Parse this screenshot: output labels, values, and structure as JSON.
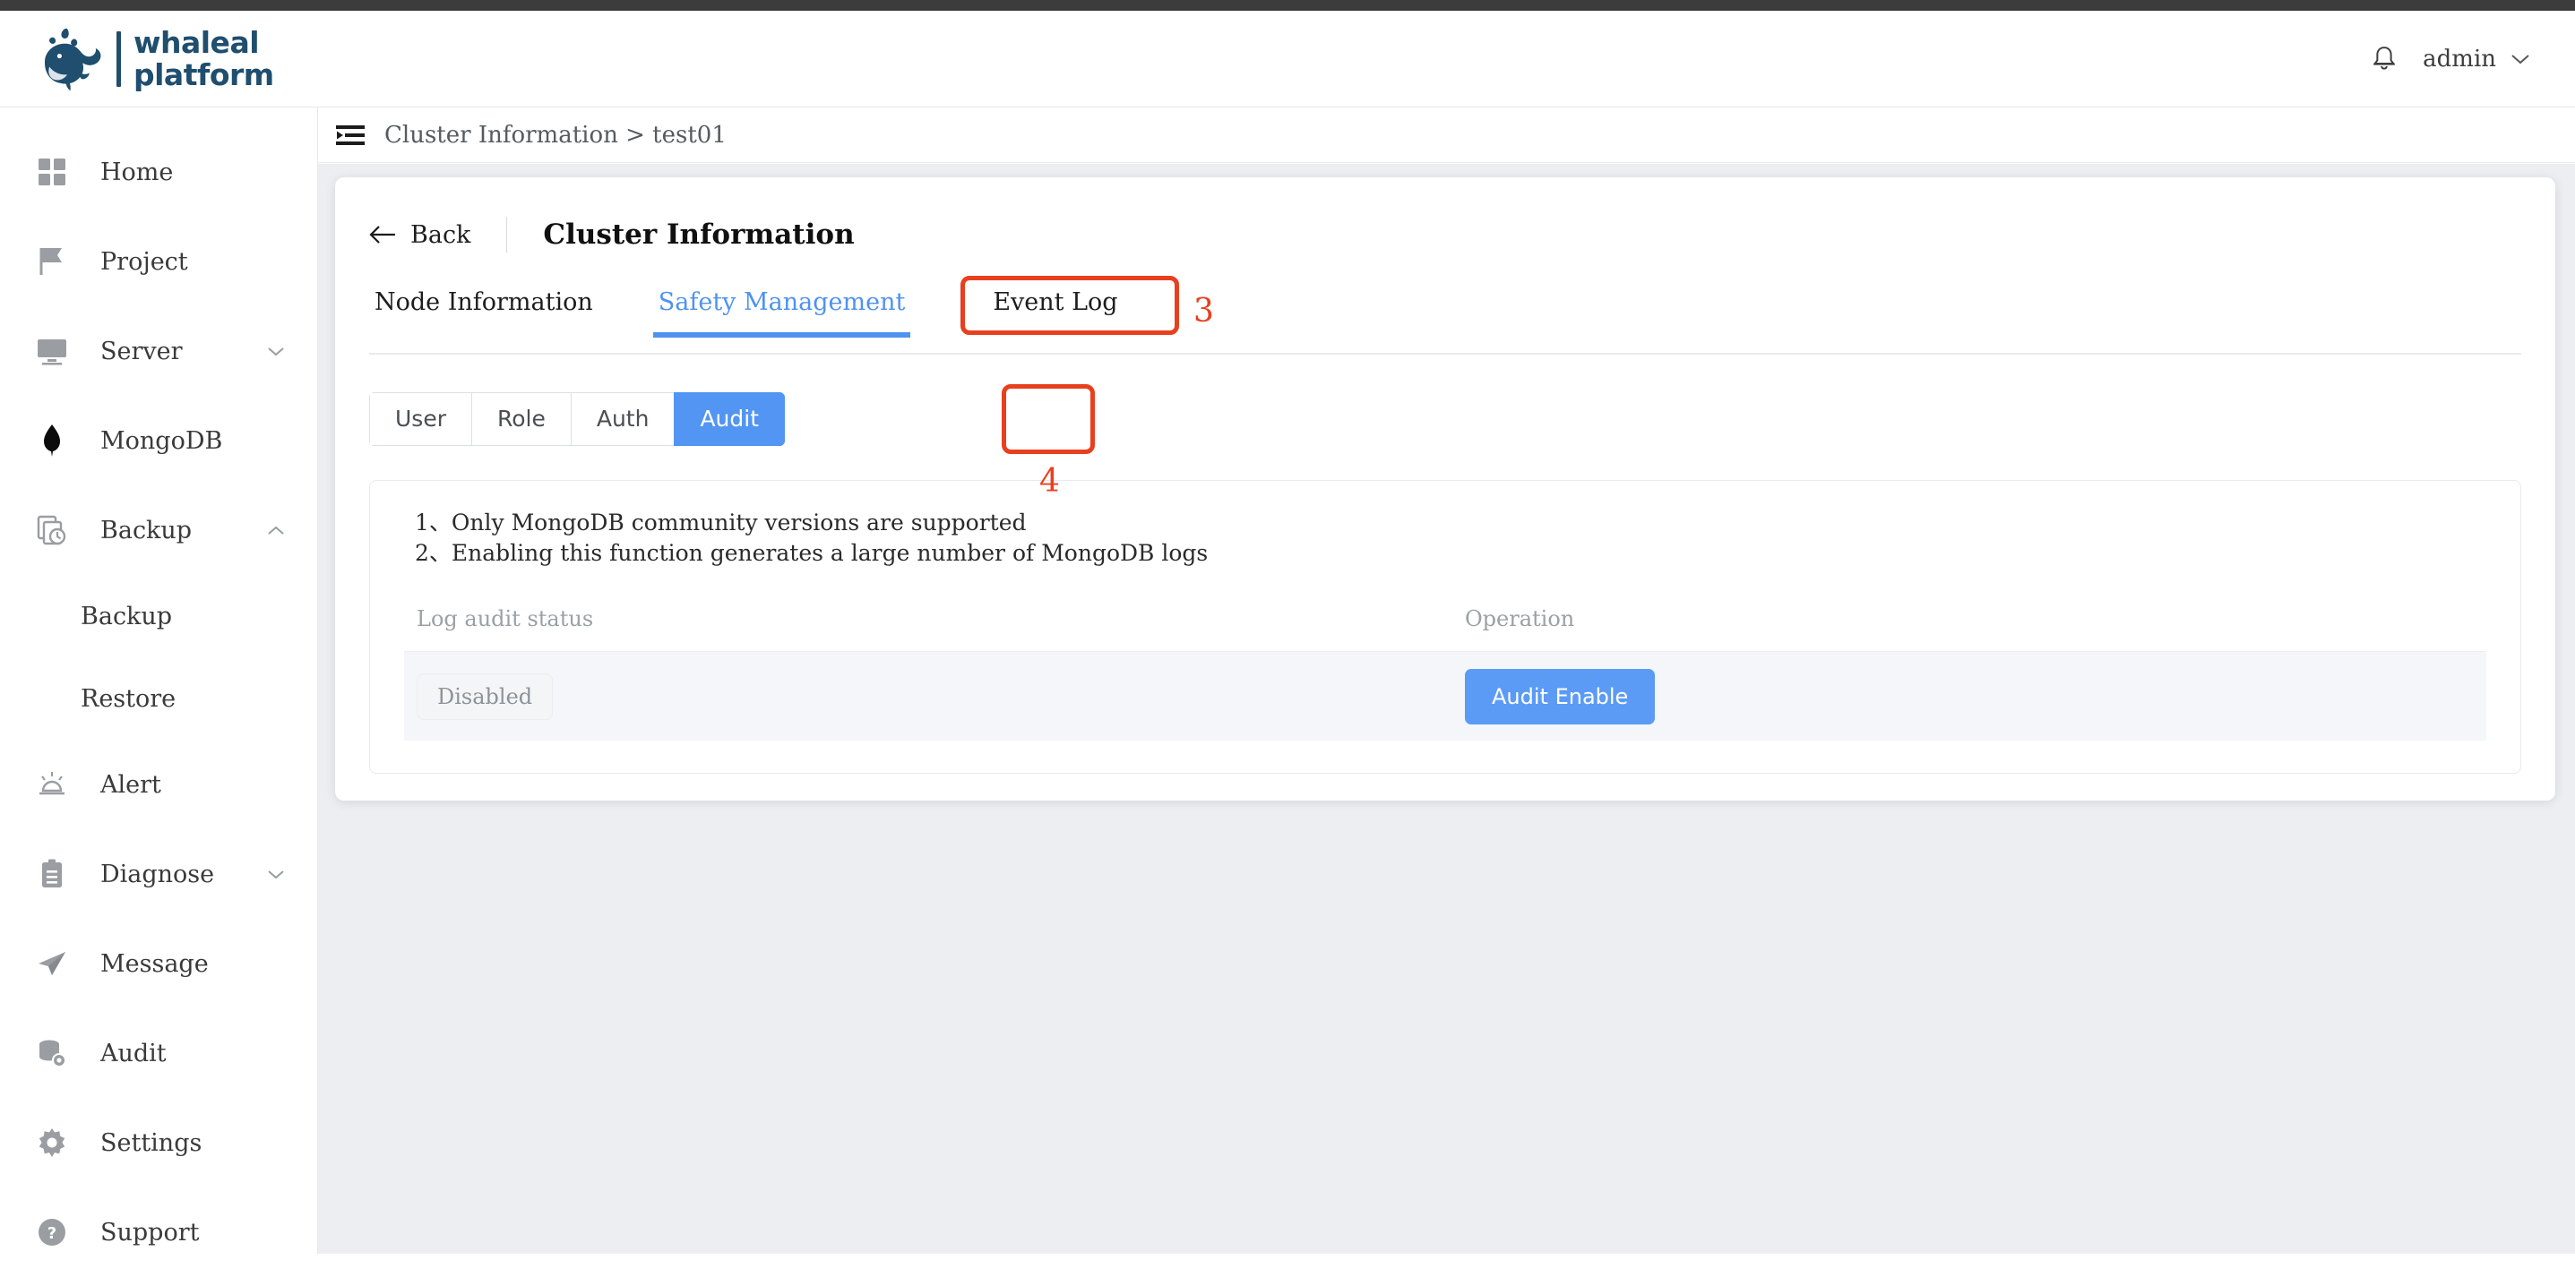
{
  "brand": {
    "logo_icon": "whale-logo-icon",
    "line1": "whaleal",
    "line2": "platform",
    "color": "#1f4e6e"
  },
  "topbar": {
    "notification_icon": "bell-icon",
    "user_name": "admin",
    "user_caret_icon": "chevron-down-icon"
  },
  "sidebar": {
    "items": [
      {
        "label": "Home",
        "icon": "grid-icon",
        "expandable": false
      },
      {
        "label": "Project",
        "icon": "flag-icon",
        "expandable": false
      },
      {
        "label": "Server",
        "icon": "monitor-icon",
        "expandable": true,
        "caret": "chevron-down-icon"
      },
      {
        "label": "MongoDB",
        "icon": "mongodb-leaf-icon",
        "expandable": false
      },
      {
        "label": "Backup",
        "icon": "backup-clock-icon",
        "expandable": true,
        "caret": "chevron-up-icon"
      },
      {
        "label": "Backup",
        "icon": "",
        "sub": true
      },
      {
        "label": "Restore",
        "icon": "",
        "sub": true
      },
      {
        "label": "Alert",
        "icon": "alarm-icon",
        "expandable": false
      },
      {
        "label": "Diagnose",
        "icon": "clipboard-icon",
        "expandable": true,
        "caret": "chevron-down-icon"
      },
      {
        "label": "Message",
        "icon": "send-icon",
        "expandable": false
      },
      {
        "label": "Audit",
        "icon": "database-eye-icon",
        "expandable": false
      },
      {
        "label": "Settings",
        "icon": "gear-icon",
        "expandable": false
      },
      {
        "label": "Support",
        "icon": "question-circle-icon",
        "expandable": false
      }
    ]
  },
  "breadcrumb": {
    "menu_icon": "collapse-menu-icon",
    "text": "Cluster Information > test01"
  },
  "card": {
    "back_icon": "arrow-left-icon",
    "back_label": "Back",
    "title": "Cluster Information",
    "tabs": [
      {
        "label": "Node Information",
        "active": false
      },
      {
        "label": "Safety Management",
        "active": true
      },
      {
        "label": "Event Log",
        "active": false
      }
    ],
    "sub_tabs": [
      {
        "label": "User",
        "active": false
      },
      {
        "label": "Role",
        "active": false
      },
      {
        "label": "Auth",
        "active": false
      },
      {
        "label": "Audit",
        "active": true
      }
    ],
    "notes": [
      "1、Only MongoDB community versions are supported",
      "2、Enabling this function generates a large number of MongoDB logs"
    ],
    "table": {
      "headers": [
        "Log audit status",
        "Operation"
      ],
      "rows": [
        {
          "status": "Disabled",
          "action": "Audit Enable"
        }
      ]
    }
  },
  "annotations": [
    {
      "number": "3",
      "target": "Safety Management tab",
      "color": "#e8401f"
    },
    {
      "number": "4",
      "target": "Audit sub-tab",
      "color": "#e8401f"
    }
  ],
  "colors": {
    "accent_blue": "#5295f2",
    "button_blue": "#5b9bf5",
    "annotation_red": "#e8401f",
    "brand_navy": "#1f4e6e",
    "page_bg": "#eceef1"
  }
}
